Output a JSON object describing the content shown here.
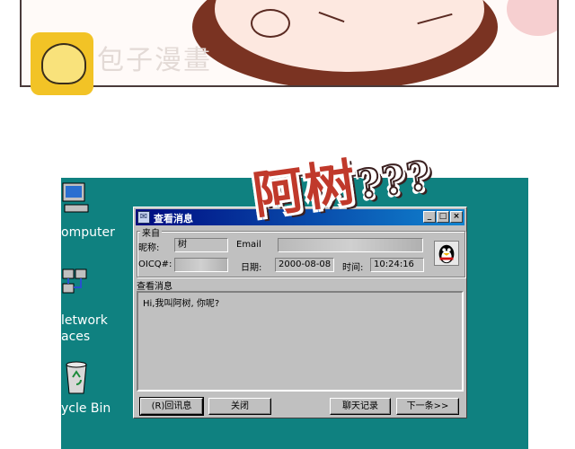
{
  "watermark": {
    "text": "包子漫畫"
  },
  "desktop": {
    "icons": [
      {
        "label": "omputer",
        "icon": "my-computer-icon"
      },
      {
        "label": "letwork",
        "icon": "network-places-icon"
      },
      {
        "label": "aces",
        "icon": ""
      },
      {
        "label": "ycle Bin",
        "icon": "recycle-bin-icon"
      }
    ]
  },
  "window": {
    "title": "查看消息",
    "from_group_label": "来自",
    "nickname_label": "昵称:",
    "nickname_value": "树",
    "email_label": "Email",
    "email_value": "",
    "oicq_label": "OICQ#:",
    "oicq_value": "",
    "date_label": "日期:",
    "date_value": "2000-08-08",
    "time_label": "时间:",
    "time_value": "10:24:16",
    "message_label": "查看消息",
    "message_text": "Hi,我叫阿树, 你呢?",
    "buttons": {
      "reply": "(R)回讯息",
      "close": "关闭",
      "chat_history": "聊天记录",
      "next": "下一条>>"
    },
    "titlebar_buttons": [
      "_",
      "□",
      "×"
    ]
  },
  "overlay": {
    "text": "阿树",
    "marks": "???"
  },
  "colors": {
    "desktop": "#0f8180",
    "titlebar": "#000a80",
    "overlay": "#c0392b",
    "logo": "#f2c326"
  }
}
